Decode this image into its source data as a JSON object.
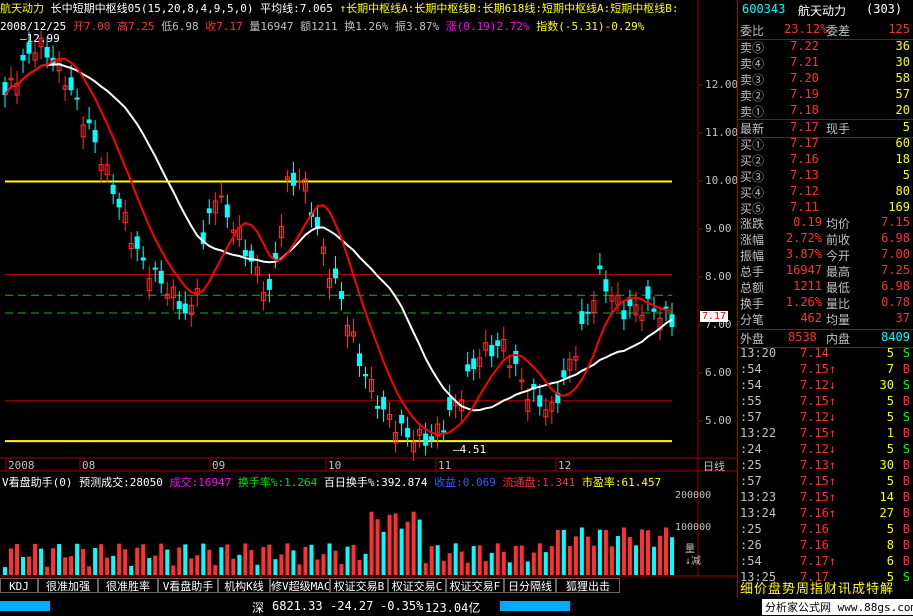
{
  "header": {
    "stock_name": "航天动力",
    "indicator": "长中短期中枢线05(15,20,8,4,9,5,0)",
    "avg_label": "平均线:7.065",
    "lines": "↑长期中枢线A:长期中枢线B:长期618线:短期中枢线A:短期中枢线B:",
    "date": "2008/12/25",
    "open": "开7.00",
    "high": "高7.25",
    "low": "低6.98",
    "close": "收7.17",
    "volume": "量16947",
    "amount": "额1211",
    "turnover": "换1.26%",
    "amplitude": "振3.87%",
    "change": "涨(0.19)2.72%",
    "index": "指数(-5.31)-0.29%"
  },
  "price_axis": [
    "12.00",
    "11.00",
    "10.00",
    "9.00",
    "8.00",
    "7.00",
    "6.00",
    "5.00"
  ],
  "price_marks": {
    "high_label": "12.99",
    "low_label": "4.51",
    "current_tag": "7.17"
  },
  "x_axis": {
    "labels": [
      "2008",
      "08",
      "09",
      "10",
      "11",
      "12"
    ],
    "mode": "日线"
  },
  "volume_header": {
    "title": "V看盘助手(0)",
    "forecast": "预测成交:28050",
    "volume": "成交:16947",
    "turnover_rate": "换手率%:1.264",
    "hundred_day": "百日换手%:392.874",
    "income": "收益:0.069",
    "circulating": "流通盘:1.341",
    "pe": "市盈率:61.457"
  },
  "volume_axis": [
    "200000",
    "100000"
  ],
  "volume_side_label": "量\n↓减",
  "tabs": [
    "KDJ",
    "很准加强",
    "很准胜率",
    "V看盘助手",
    "机构K线",
    "修V超级MACD",
    "权证交易B",
    "权证交易C",
    "权证交易F",
    "日分隔线",
    "狐狸出击"
  ],
  "right": {
    "code": "600343",
    "name": "航天动力",
    "num": "(303)",
    "ratio_label": "委比",
    "ratio": "23.12%",
    "diff_label": "委差",
    "diff": "125",
    "asks": [
      {
        "l": "卖⑤",
        "p": "7.22",
        "v": "36"
      },
      {
        "l": "卖④",
        "p": "7.21",
        "v": "30"
      },
      {
        "l": "卖③",
        "p": "7.20",
        "v": "58"
      },
      {
        "l": "卖②",
        "p": "7.19",
        "v": "57"
      },
      {
        "l": "卖①",
        "p": "7.18",
        "v": "20"
      }
    ],
    "last_label": "最新",
    "last": "7.17",
    "hand_label": "现手",
    "hand": "5",
    "bids": [
      {
        "l": "买①",
        "p": "7.17",
        "v": "60"
      },
      {
        "l": "买②",
        "p": "7.16",
        "v": "18"
      },
      {
        "l": "买③",
        "p": "7.13",
        "v": "5"
      },
      {
        "l": "买④",
        "p": "7.12",
        "v": "80"
      },
      {
        "l": "买⑤",
        "p": "7.11",
        "v": "169"
      }
    ],
    "stats": [
      {
        "a": "涨跌",
        "b": "0.19",
        "c": "均价",
        "d": "7.15"
      },
      {
        "a": "涨幅",
        "b": "2.72%",
        "c": "前收",
        "d": "6.98"
      },
      {
        "a": "振幅",
        "b": "3.87%",
        "c": "今开",
        "d": "7.00"
      },
      {
        "a": "总手",
        "b": "16947",
        "c": "最高",
        "d": "7.25"
      },
      {
        "a": "总额",
        "b": "1211",
        "c": "最低",
        "d": "6.98"
      },
      {
        "a": "换手",
        "b": "1.26%",
        "c": "量比",
        "d": "0.78"
      },
      {
        "a": "分笔",
        "b": "462",
        "c": "均量",
        "d": "37"
      }
    ],
    "outer_label": "外盘",
    "outer": "8538",
    "inner_label": "内盘",
    "inner": "8409",
    "ticks": [
      {
        "t": "13:20",
        "p": "7.14",
        "a": "",
        "v": "5",
        "s": "S"
      },
      {
        "t": ":54",
        "p": "7.15",
        "a": "↑",
        "v": "7",
        "s": "B"
      },
      {
        "t": ":54",
        "p": "7.12",
        "a": "↓",
        "v": "30",
        "s": "S"
      },
      {
        "t": ":55",
        "p": "7.15",
        "a": "↑",
        "v": "5",
        "s": "B"
      },
      {
        "t": ":57",
        "p": "7.12",
        "a": "↓",
        "v": "5",
        "s": "S"
      },
      {
        "t": "13:22",
        "p": "7.15",
        "a": "↑",
        "v": "1",
        "s": "B"
      },
      {
        "t": ":24",
        "p": "7.12",
        "a": "↓",
        "v": "5",
        "s": "S"
      },
      {
        "t": ":25",
        "p": "7.13",
        "a": "↑",
        "v": "30",
        "s": "B"
      },
      {
        "t": ":57",
        "p": "7.15",
        "a": "↑",
        "v": "5",
        "s": "B"
      },
      {
        "t": "13:23",
        "p": "7.15",
        "a": "↑",
        "v": "14",
        "s": "B"
      },
      {
        "t": "13:24",
        "p": "7.16",
        "a": "↑",
        "v": "27",
        "s": "B"
      },
      {
        "t": ":25",
        "p": "7.16",
        "a": "",
        "v": "5",
        "s": "B"
      },
      {
        "t": ":26",
        "p": "7.16",
        "a": "",
        "v": "8",
        "s": "B"
      },
      {
        "t": ":54",
        "p": "7.17",
        "a": "↑",
        "v": "6",
        "s": "B"
      },
      {
        "t": "13:25",
        "p": "7.17",
        "a": "",
        "v": "5",
        "s": "S"
      }
    ],
    "bottom_tabs": "细价盘势周指财讯成特解"
  },
  "status": {
    "market": "深",
    "index": "6821.33",
    "change": "-24.27",
    "pct": "-0.35%",
    "amount": "123.04亿",
    "watermark": "分析家公式网 www.88gs.com"
  },
  "colors": {
    "up": "#ff3030",
    "down": "#00ffff",
    "grid": "#a00000",
    "ma_white": "#ffffff",
    "ma_red": "#ff0000",
    "level": "#ffff00"
  }
}
